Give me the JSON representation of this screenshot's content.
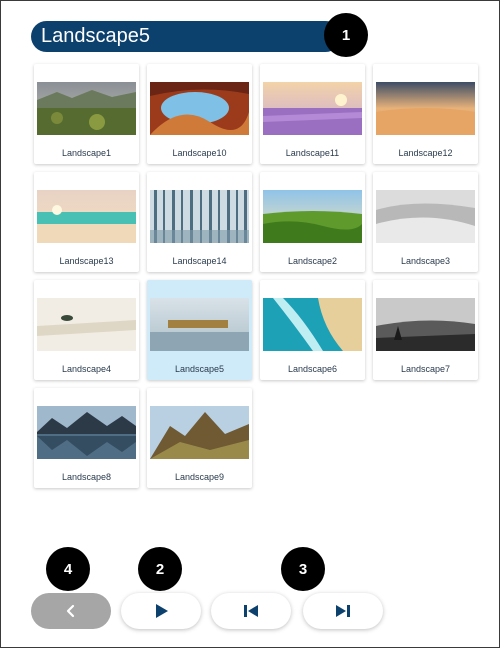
{
  "header": {
    "title": "Landscape5"
  },
  "callouts": [
    "1",
    "2",
    "3",
    "4"
  ],
  "gallery": {
    "selected": "Landscape5",
    "items": [
      {
        "label": "Landscape1"
      },
      {
        "label": "Landscape10"
      },
      {
        "label": "Landscape11"
      },
      {
        "label": "Landscape12"
      },
      {
        "label": "Landscape13"
      },
      {
        "label": "Landscape14"
      },
      {
        "label": "Landscape2"
      },
      {
        "label": "Landscape3"
      },
      {
        "label": "Landscape4"
      },
      {
        "label": "Landscape5"
      },
      {
        "label": "Landscape6"
      },
      {
        "label": "Landscape7"
      },
      {
        "label": "Landscape8"
      },
      {
        "label": "Landscape9"
      }
    ]
  },
  "nav": {
    "buttons": [
      {
        "name": "previous-button",
        "icon": "chevron-left-icon",
        "disabled": true
      },
      {
        "name": "play-button",
        "icon": "play-icon",
        "disabled": false
      },
      {
        "name": "first-button",
        "icon": "skip-first-icon",
        "disabled": false
      },
      {
        "name": "last-button",
        "icon": "skip-last-icon",
        "disabled": false
      }
    ]
  },
  "colors": {
    "title_bg": "#0c416e",
    "selected_bg": "#cfeaf8",
    "disabled_btn": "#a6a6a6",
    "icon": "#0c416e"
  }
}
